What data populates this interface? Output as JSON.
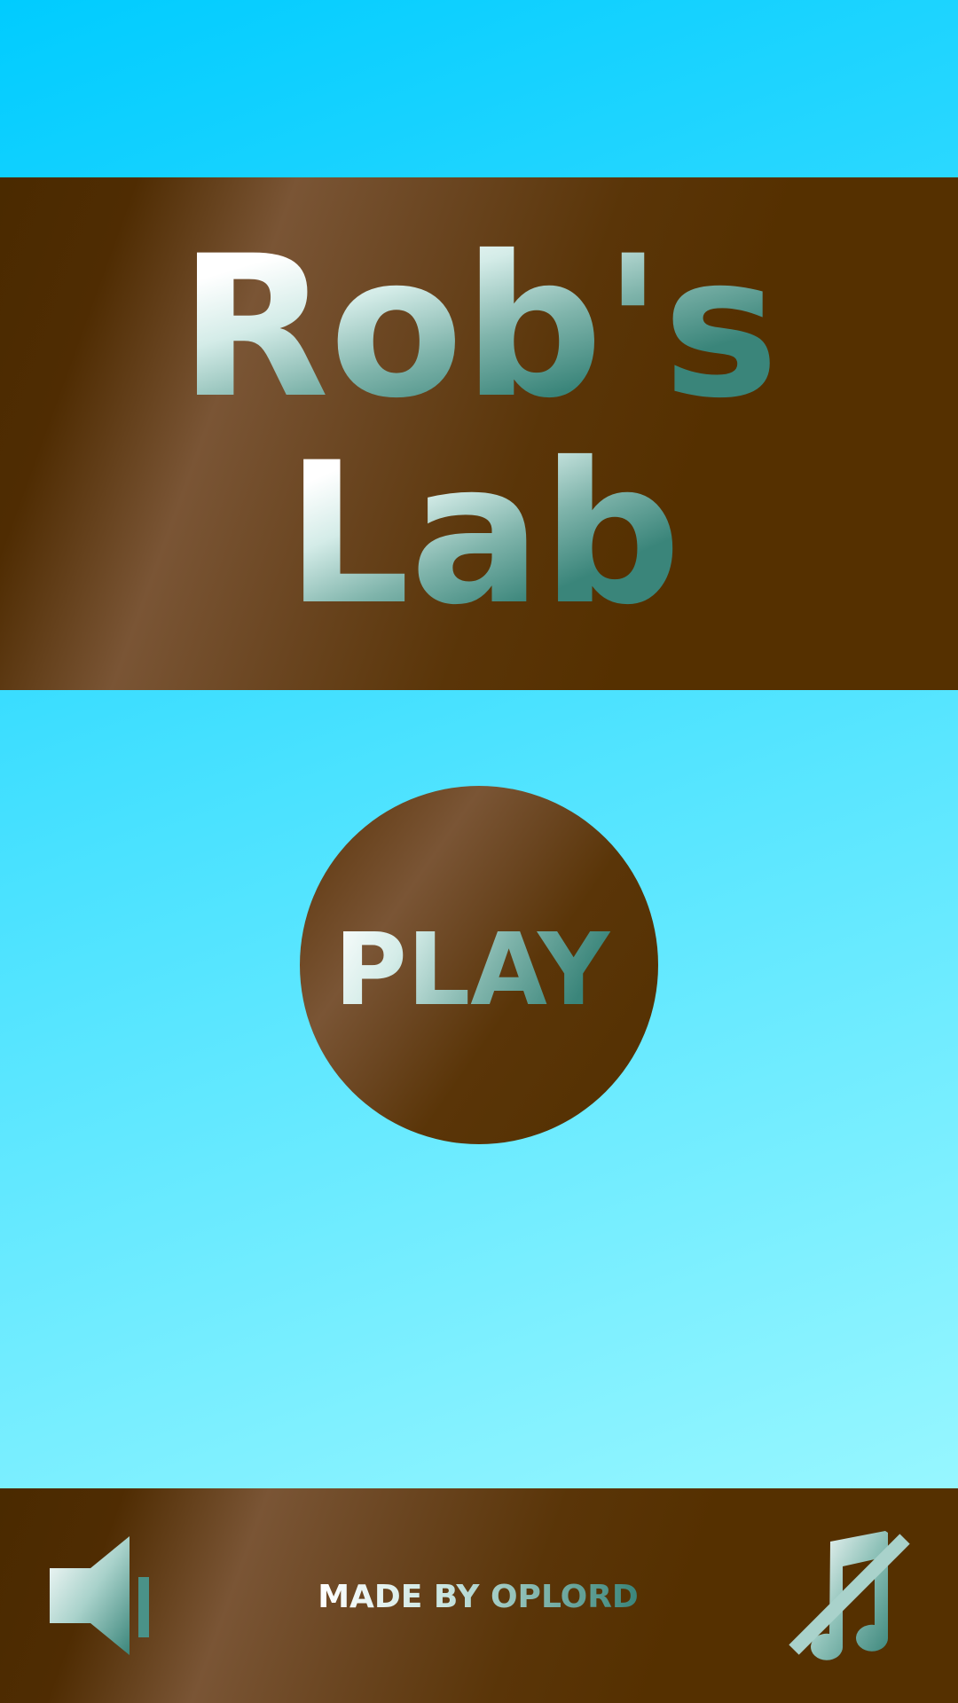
{
  "title": {
    "line1": "Rob's",
    "line2": "Lab"
  },
  "play_button": {
    "label": "PLAY"
  },
  "footer": {
    "credit_prefix": "MADE BY ",
    "credit_author": "OPLORD"
  },
  "controls": {
    "sound_icon": "speaker-icon",
    "music_icon": "music-muted-icon"
  },
  "colors": {
    "sky_top": "#00ccff",
    "sky_bottom": "#a8fbff",
    "wood_dark": "#553000",
    "wood_light": "#7a5535",
    "text_light": "#ffffff",
    "text_teal": "#3a857a"
  }
}
